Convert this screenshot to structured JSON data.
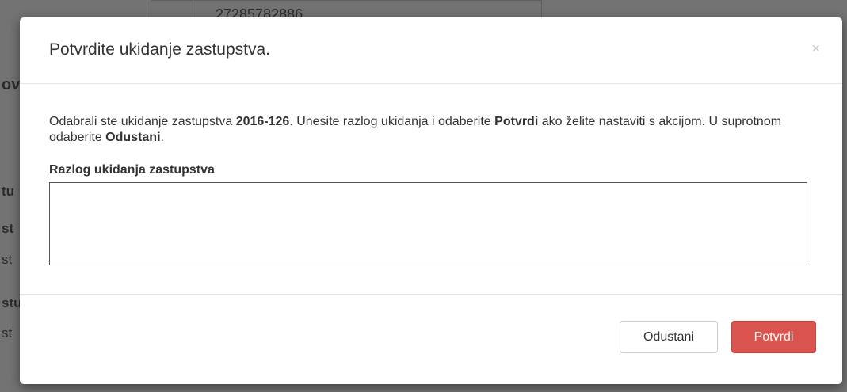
{
  "background": {
    "top_number": "27285782886",
    "fragments": [
      "ov",
      "tu",
      "st",
      "st",
      "stu",
      "st"
    ]
  },
  "modal": {
    "title": "Potvrdite ukidanje zastupstva.",
    "close_glyph": "×",
    "description": {
      "part1": "Odabrali ste ukidanje zastupstva ",
      "code": "2016-126",
      "part2": ". Unesite razlog ukidanja i odaberite ",
      "confirm_ref": "Potvrdi",
      "part3": " ako želite nastaviti s akcijom. U suprotnom odaberite ",
      "cancel_ref": "Odustani",
      "part4": "."
    },
    "field_label": "Razlog ukidanja zastupstva",
    "reason_value": "",
    "buttons": {
      "cancel": "Odustani",
      "confirm": "Potvrdi"
    }
  },
  "colors": {
    "confirm_button": "#d9534f",
    "backdrop": "#737373"
  }
}
